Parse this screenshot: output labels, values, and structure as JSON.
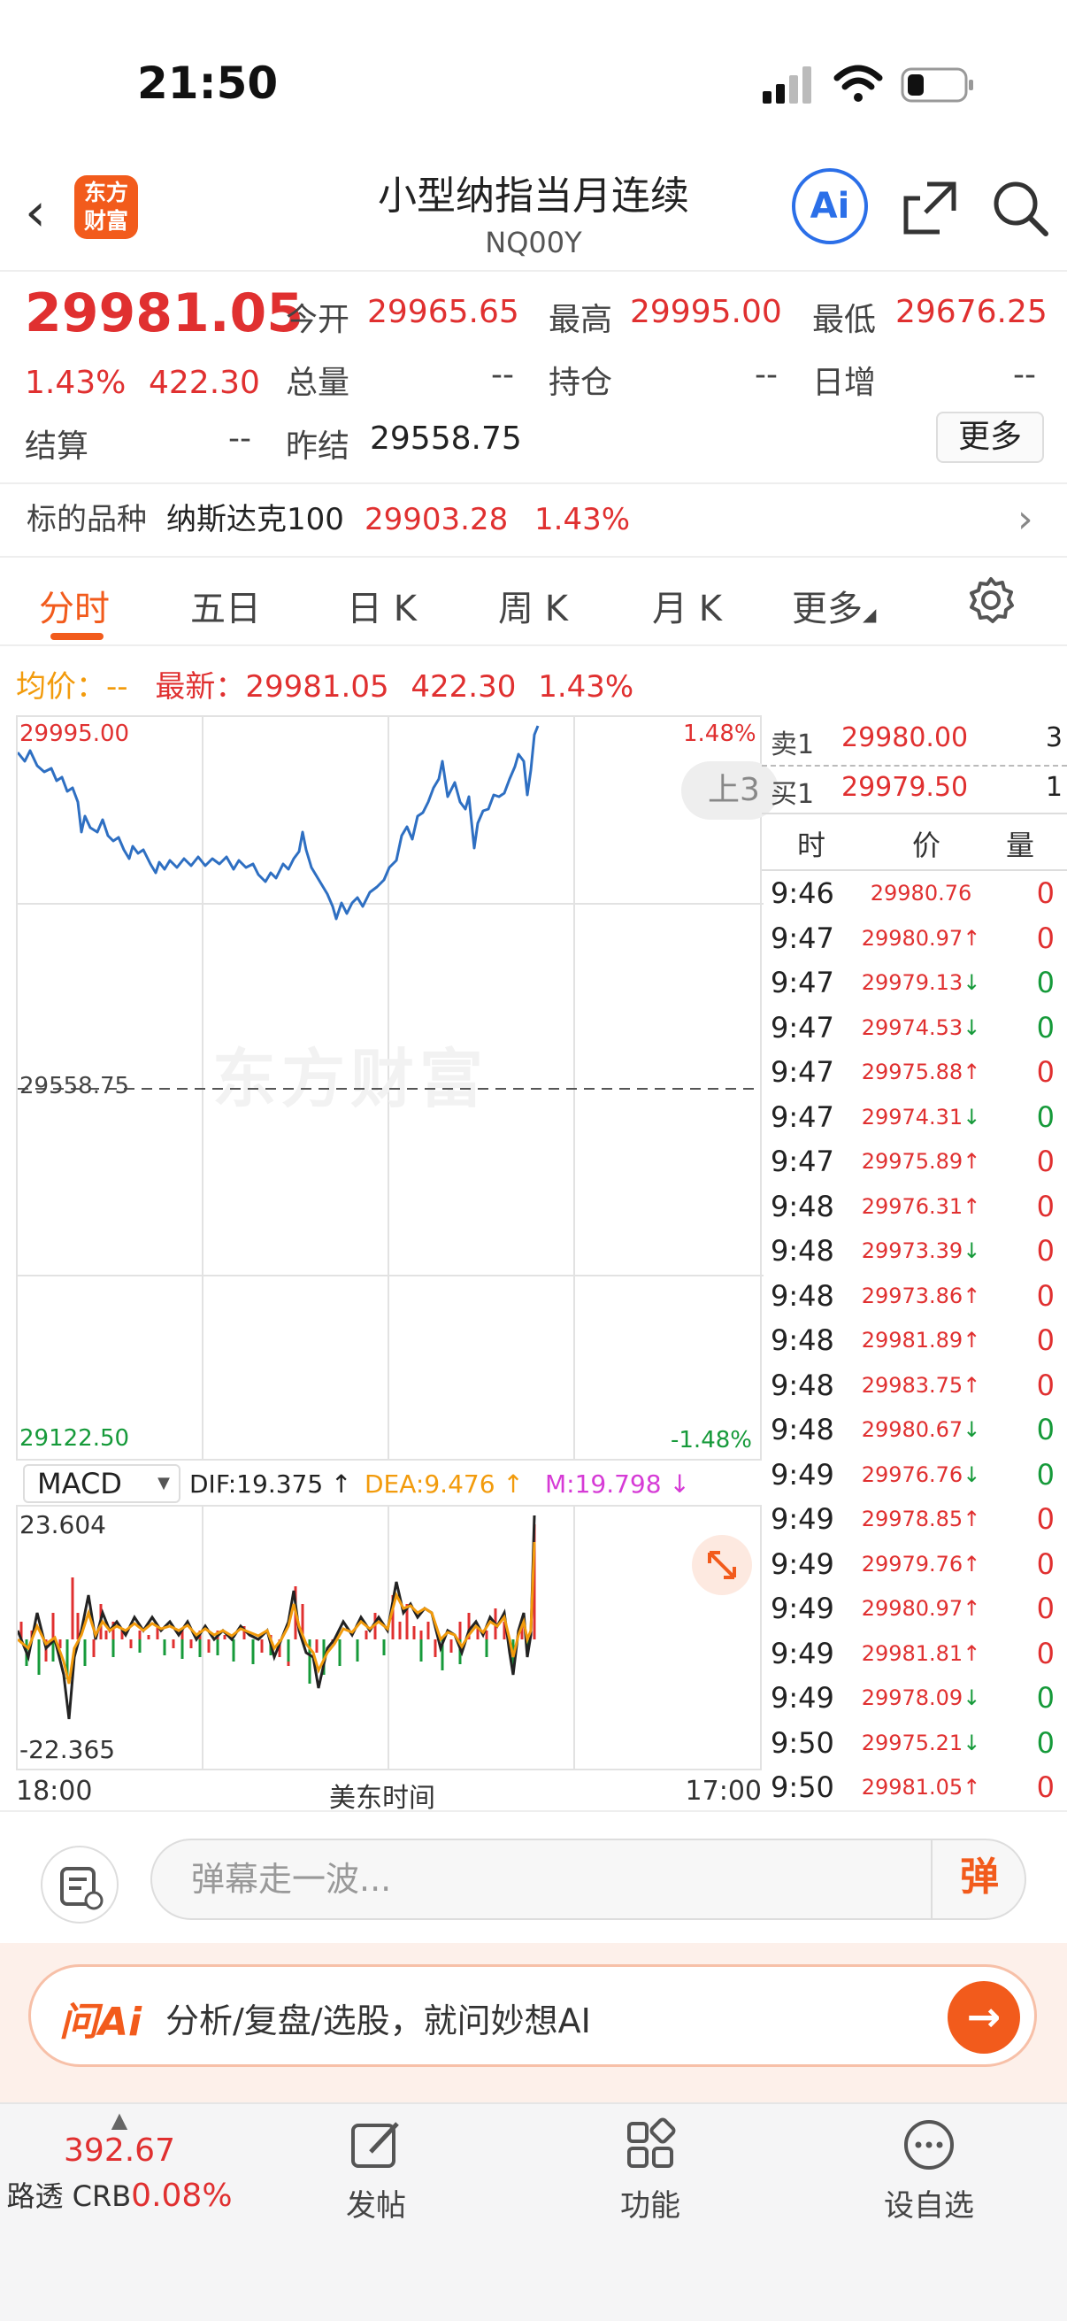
{
  "status": {
    "time": "21:50"
  },
  "nav": {
    "back": "‹",
    "logo": "东方财富",
    "title": "小型纳指当月连续",
    "code": "NQ00Y",
    "ai": "Ai"
  },
  "quote": {
    "price": "29981.05",
    "change_pct": "1.43%",
    "change": "422.30",
    "open_label": "今开",
    "open": "29965.65",
    "high_label": "最高",
    "high": "29995.00",
    "low_label": "最低",
    "low": "29676.25",
    "volume_label": "总量",
    "volume": "--",
    "oi_label": "持仓",
    "oi": "--",
    "daily_inc_label": "日增",
    "daily_inc": "--",
    "settle_label": "结算",
    "settle": "--",
    "prev_settle_label": "昨结",
    "prev_settle": "29558.75",
    "more": "更多"
  },
  "underlying": {
    "label": "标的品种",
    "name": "纳斯达克100",
    "price": "29903.28",
    "pct": "1.43%"
  },
  "tabs": [
    "分时",
    "五日",
    "日 K",
    "周 K",
    "月 K",
    "更多"
  ],
  "infoline": {
    "avg_label": "均价：",
    "avg": "--",
    "latest_label": "最新：",
    "latest": "29981.05",
    "chg": "422.30",
    "pct": "1.43%"
  },
  "chart": {
    "ymax": "29995.00",
    "ymid": "29558.75",
    "ymin": "29122.50",
    "pmax": "1.48%",
    "pmin": "-1.48%",
    "watermark": "东方财富",
    "side_pill": "上3"
  },
  "macd": {
    "selector": "MACD",
    "dif": "DIF:19.375 ↑",
    "dea": "DEA:9.476 ↑",
    "m": "M:19.798 ↓",
    "max": "23.604",
    "min": "-22.365"
  },
  "xaxis": {
    "start": "18:00",
    "mid": "美东时间",
    "end": "17:00"
  },
  "orderbook": {
    "ask_label": "卖1",
    "ask": "29980.00",
    "ask_qty": "3",
    "bid_label": "买1",
    "bid": "29979.50",
    "bid_qty": "1",
    "h_time": "时",
    "h_price": "价",
    "h_qty": "量",
    "ticks": [
      {
        "t": "9:46",
        "p": "29980.76",
        "d": "",
        "q": "0",
        "c": "red"
      },
      {
        "t": "9:47",
        "p": "29980.97",
        "d": "↑",
        "q": "0",
        "c": "red"
      },
      {
        "t": "9:47",
        "p": "29979.13",
        "d": "↓",
        "q": "0",
        "c": "green"
      },
      {
        "t": "9:47",
        "p": "29974.53",
        "d": "↓",
        "q": "0",
        "c": "green"
      },
      {
        "t": "9:47",
        "p": "29975.88",
        "d": "↑",
        "q": "0",
        "c": "red"
      },
      {
        "t": "9:47",
        "p": "29974.31",
        "d": "↓",
        "q": "0",
        "c": "green"
      },
      {
        "t": "9:47",
        "p": "29975.89",
        "d": "↑",
        "q": "0",
        "c": "red"
      },
      {
        "t": "9:48",
        "p": "29976.31",
        "d": "↑",
        "q": "0",
        "c": "red"
      },
      {
        "t": "9:48",
        "p": "29973.39",
        "d": "↓",
        "q": "0",
        "c": "red"
      },
      {
        "t": "9:48",
        "p": "29973.86",
        "d": "↑",
        "q": "0",
        "c": "red"
      },
      {
        "t": "9:48",
        "p": "29981.89",
        "d": "↑",
        "q": "0",
        "c": "red"
      },
      {
        "t": "9:48",
        "p": "29983.75",
        "d": "↑",
        "q": "0",
        "c": "red"
      },
      {
        "t": "9:48",
        "p": "29980.67",
        "d": "↓",
        "q": "0",
        "c": "green"
      },
      {
        "t": "9:49",
        "p": "29976.76",
        "d": "↓",
        "q": "0",
        "c": "green"
      },
      {
        "t": "9:49",
        "p": "29978.85",
        "d": "↑",
        "q": "0",
        "c": "red"
      },
      {
        "t": "9:49",
        "p": "29979.76",
        "d": "↑",
        "q": "0",
        "c": "red"
      },
      {
        "t": "9:49",
        "p": "29980.97",
        "d": "↑",
        "q": "0",
        "c": "red"
      },
      {
        "t": "9:49",
        "p": "29981.81",
        "d": "↑",
        "q": "0",
        "c": "red"
      },
      {
        "t": "9:49",
        "p": "29978.09",
        "d": "↓",
        "q": "0",
        "c": "green"
      },
      {
        "t": "9:50",
        "p": "29975.21",
        "d": "↓",
        "q": "0",
        "c": "green"
      },
      {
        "t": "9:50",
        "p": "29981.05",
        "d": "↑",
        "q": "0",
        "c": "red"
      }
    ]
  },
  "danmu": {
    "placeholder": "弹幕走一波...",
    "btn": "弹"
  },
  "ai_bar": {
    "label": "问Ai",
    "prompt": "分析/复盘/选股，就问妙想AI",
    "go": "→"
  },
  "tabbar": {
    "index_value": "392.67",
    "index_name": "路透 CRB",
    "index_pct": "0.08%",
    "post": "发帖",
    "func": "功能",
    "add": "设自选"
  },
  "colors": {
    "accent": "#f25b1c",
    "up": "#e03030",
    "down": "#169a3a",
    "line": "#2e6fc2",
    "dea": "#f29b0c"
  }
}
